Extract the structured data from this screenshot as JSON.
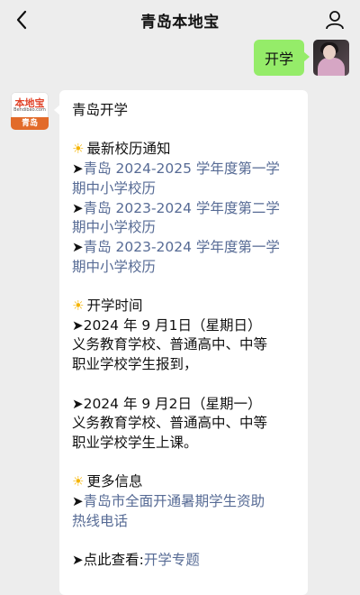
{
  "header": {
    "title": "青岛本地宝"
  },
  "user_message": {
    "text": "开学"
  },
  "bot": {
    "avatar": {
      "brand": "本地宝",
      "domain": "Bendibao.com",
      "city": "青岛"
    },
    "title": "青岛开学",
    "sections": [
      {
        "heading": "最新校历通知",
        "links": [
          [
            "青岛 2024-2025 学年度第一学",
            "期中小学校历"
          ],
          [
            "青岛 2023-2024 学年度第二学",
            "期中小学校历"
          ],
          [
            "青岛 2023-2024 学年度第一学",
            "期中小学校历"
          ]
        ]
      },
      {
        "heading": "开学时间",
        "items": [
          [
            "2024 年 9 月1日（星期日）",
            "义务教育学校、普通高中、中等",
            "职业学校学生报到，"
          ],
          [
            "2024 年 9 月2日（星期一）",
            "义务教育学校、普通高中、中等",
            "职业学校学生上课。"
          ]
        ]
      },
      {
        "heading": "更多信息",
        "link": [
          "青岛市全面开通暑期学生资助",
          "热线电话"
        ],
        "view_prefix": "点此查看:",
        "view_link": "开学专题"
      }
    ]
  },
  "icons": {
    "arrow": "➤",
    "sun": "☀"
  },
  "colors": {
    "link": "#576b95",
    "user_bubble": "#95ec69",
    "background": "#ededed"
  }
}
